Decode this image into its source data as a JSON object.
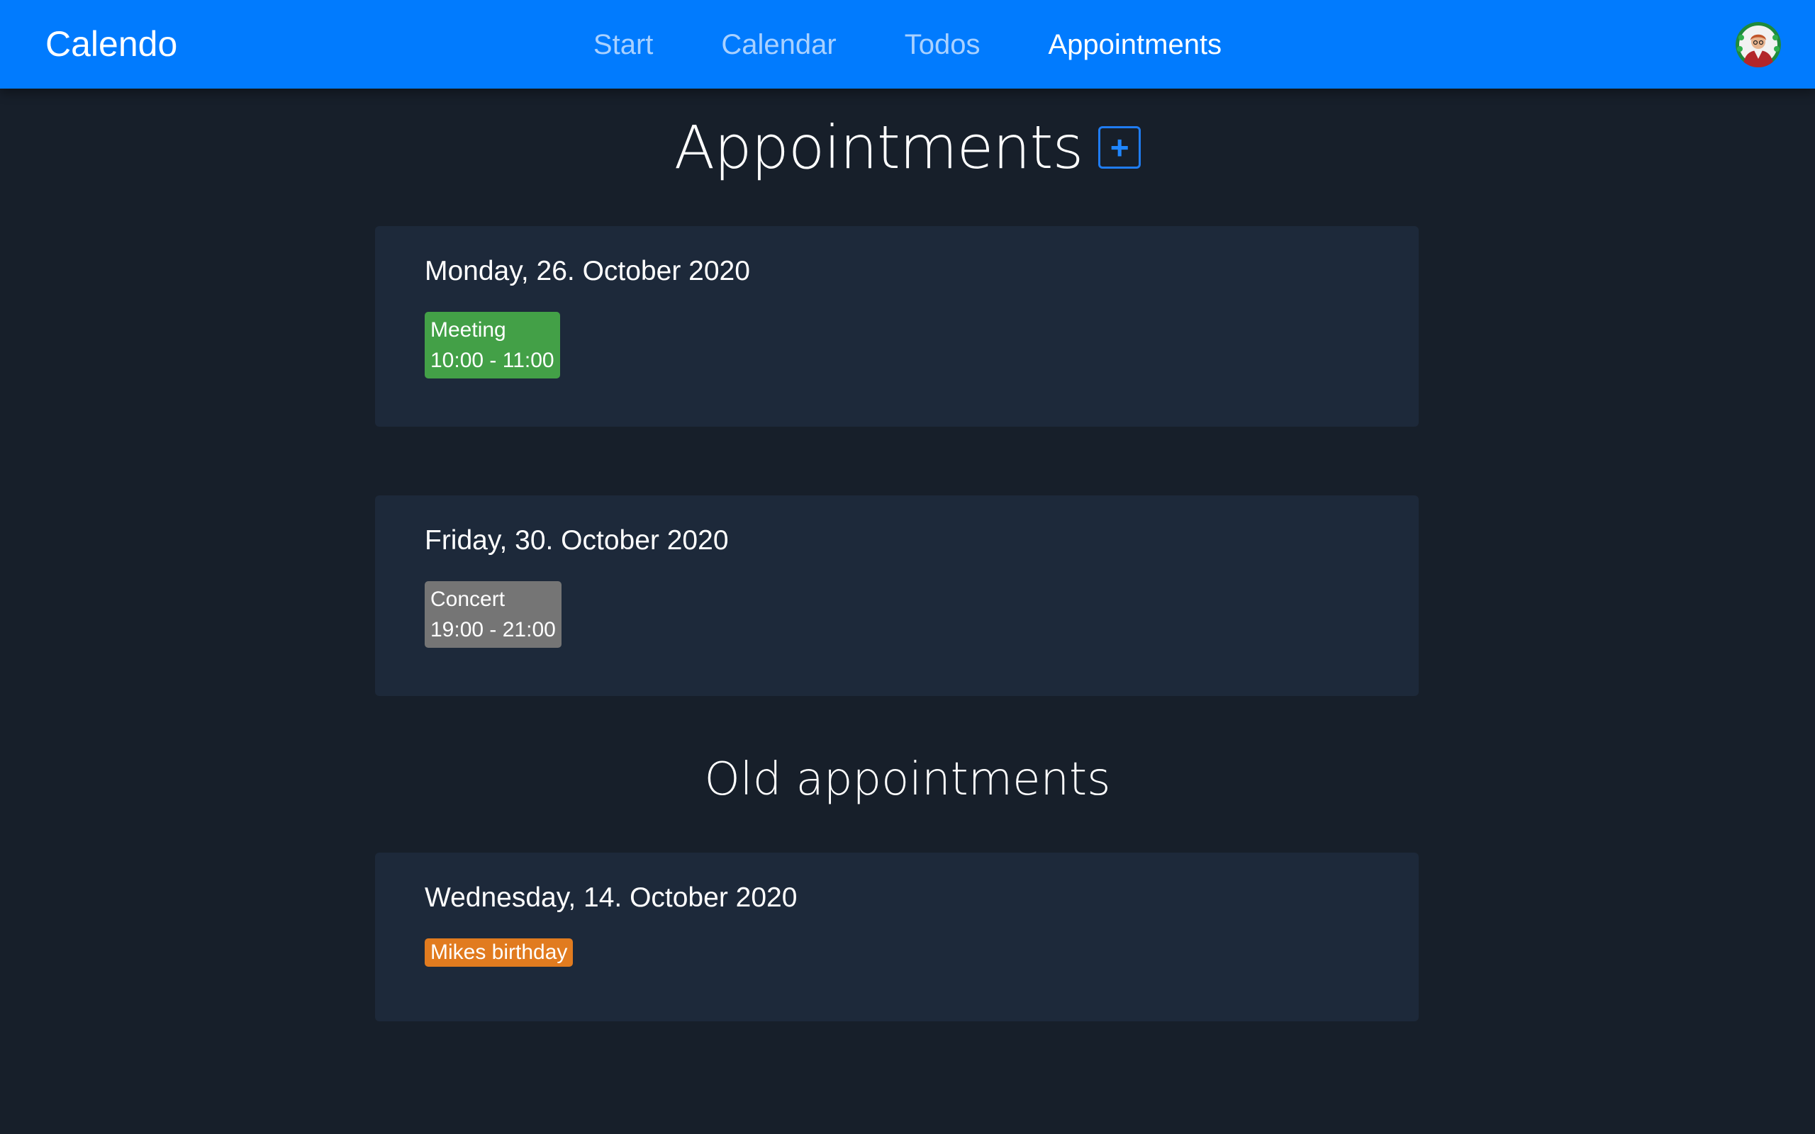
{
  "navbar": {
    "brand": "Calendo",
    "links": [
      {
        "label": "Start",
        "active": false
      },
      {
        "label": "Calendar",
        "active": false
      },
      {
        "label": "Todos",
        "active": false
      },
      {
        "label": "Appointments",
        "active": true
      }
    ],
    "avatar_icon": "user-avatar-icon"
  },
  "main": {
    "title": "Appointments",
    "add_button_label": "+",
    "upcoming": [
      {
        "date": "Monday, 26. October 2020",
        "appointments": [
          {
            "title": "Meeting",
            "time": "10:00 - 11:00",
            "color": "#43a047"
          }
        ]
      },
      {
        "date": "Friday, 30. October 2020",
        "appointments": [
          {
            "title": "Concert",
            "time": "19:00 - 21:00",
            "color": "#757575"
          }
        ]
      }
    ],
    "old_title": "Old appointments",
    "old": [
      {
        "date": "Wednesday, 14. October 2020",
        "appointments": [
          {
            "title": "Mikes birthday",
            "time": "",
            "color": "#e17b1f"
          }
        ]
      }
    ]
  },
  "colors": {
    "navbar": "#017bfe",
    "background": "#171f2a",
    "card": "#1d293a",
    "nav_inactive": "#a9d1ff"
  }
}
